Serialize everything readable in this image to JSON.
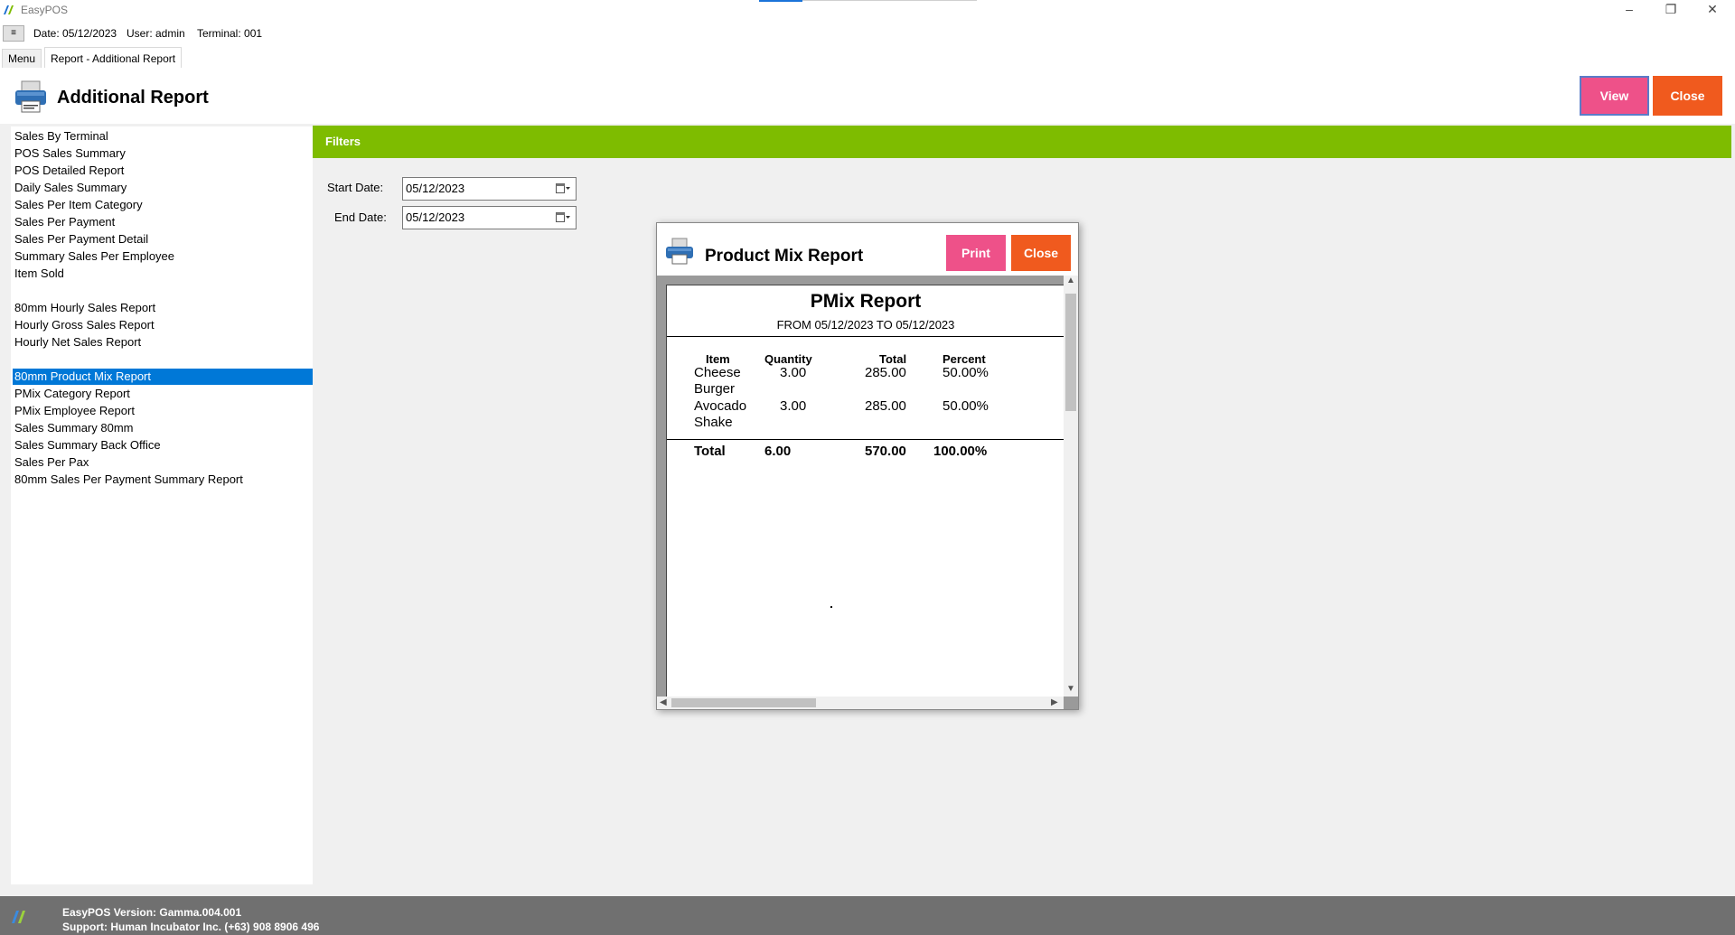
{
  "window": {
    "title": "EasyPOS",
    "min": "–",
    "max": "❐",
    "close": "✕"
  },
  "infobar": {
    "menu_toggle": "≡",
    "date": "Date: 05/12/2023",
    "user": "User: admin",
    "terminal": "Terminal: 001"
  },
  "tabs": [
    {
      "label": "Menu"
    },
    {
      "label": "Report - Additional Report"
    }
  ],
  "header": {
    "title": "Additional Report",
    "view_label": "View",
    "close_label": "Close"
  },
  "reports": [
    {
      "label": "Sales By Terminal"
    },
    {
      "label": "POS Sales Summary"
    },
    {
      "label": "POS Detailed Report"
    },
    {
      "label": "Daily Sales Summary"
    },
    {
      "label": "Sales Per Item Category"
    },
    {
      "label": "Sales Per Payment"
    },
    {
      "label": "Sales Per Payment Detail"
    },
    {
      "label": "Summary Sales Per Employee"
    },
    {
      "label": "Item Sold"
    },
    {
      "label": "80mm Hourly Sales Report"
    },
    {
      "label": "Hourly Gross Sales Report"
    },
    {
      "label": "Hourly Net Sales Report"
    },
    {
      "label": "80mm Product Mix Report",
      "selected": true
    },
    {
      "label": "PMix Category Report"
    },
    {
      "label": "PMix Employee Report"
    },
    {
      "label": "Sales Summary 80mm"
    },
    {
      "label": "Sales Summary Back Office"
    },
    {
      "label": "Sales Per Pax"
    },
    {
      "label": "80mm Sales Per Payment Summary Report"
    }
  ],
  "filters": {
    "heading": "Filters",
    "start_label": "Start Date:",
    "start_value": "05/12/2023",
    "end_label": "End Date:",
    "end_value": "05/12/2023"
  },
  "dialog": {
    "title": "Product Mix Report",
    "print_label": "Print",
    "close_label": "Close",
    "report": {
      "title": "PMix Report",
      "range": "FROM 05/12/2023 TO 05/12/2023",
      "columns": [
        "Item",
        "Quantity",
        "Total",
        "Percent"
      ],
      "rows": [
        {
          "item_line1": "Cheese",
          "item_line2": "Burger",
          "quantity": "3.00",
          "total": "285.00",
          "percent": "50.00%"
        },
        {
          "item_line1": "Avocado",
          "item_line2": "Shake",
          "quantity": "3.00",
          "total": "285.00",
          "percent": "50.00%"
        }
      ],
      "totals": {
        "label": "Total",
        "quantity": "6.00",
        "total": "570.00",
        "percent": "100.00%"
      }
    }
  },
  "footer": {
    "logo_text": "Human Incubator",
    "version": "EasyPOS Version: Gamma.004.001",
    "support": "Support: Human Incubator Inc. (+63) 908 8906 496"
  },
  "colors": {
    "accent_green": "#7ebc00",
    "pink": "#ee5189",
    "orange": "#f05a1e",
    "selected": "#0078d7",
    "footer": "#707070"
  }
}
